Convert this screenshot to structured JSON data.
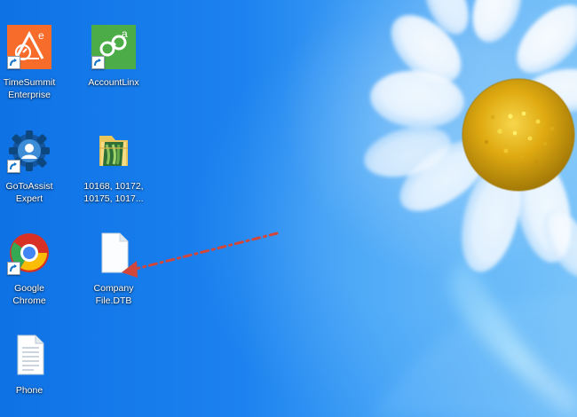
{
  "desktop": {
    "wallpaper": {
      "colors": {
        "sky_dark": "#0e72e5",
        "sky_light": "#76c1f9",
        "petal": "#f8fbff",
        "flower_center": "#e4b315",
        "stem": "#c7f0ff"
      }
    },
    "icons": [
      {
        "label": "TimeSummit\nEnterprise",
        "icon": "timesummit-app-icon",
        "shortcut": true
      },
      {
        "label": "AccountLinx",
        "icon": "accountlinx-app-icon",
        "shortcut": true
      },
      {
        "label": "GoToAssist\nExpert",
        "icon": "gotoassist-gear-icon",
        "shortcut": true
      },
      {
        "label": "10168, 10172,\n10175, 1017...",
        "icon": "folder-icon",
        "shortcut": false
      },
      {
        "label": "Google\nChrome",
        "icon": "chrome-icon",
        "shortcut": true
      },
      {
        "label": "Company\nFile.DTB",
        "icon": "blank-file-icon",
        "shortcut": false
      },
      {
        "label": "Phone",
        "icon": "text-document-icon",
        "shortcut": false
      }
    ],
    "annotation": {
      "type": "red-dashed-arrow",
      "color": "#d1473b"
    }
  }
}
